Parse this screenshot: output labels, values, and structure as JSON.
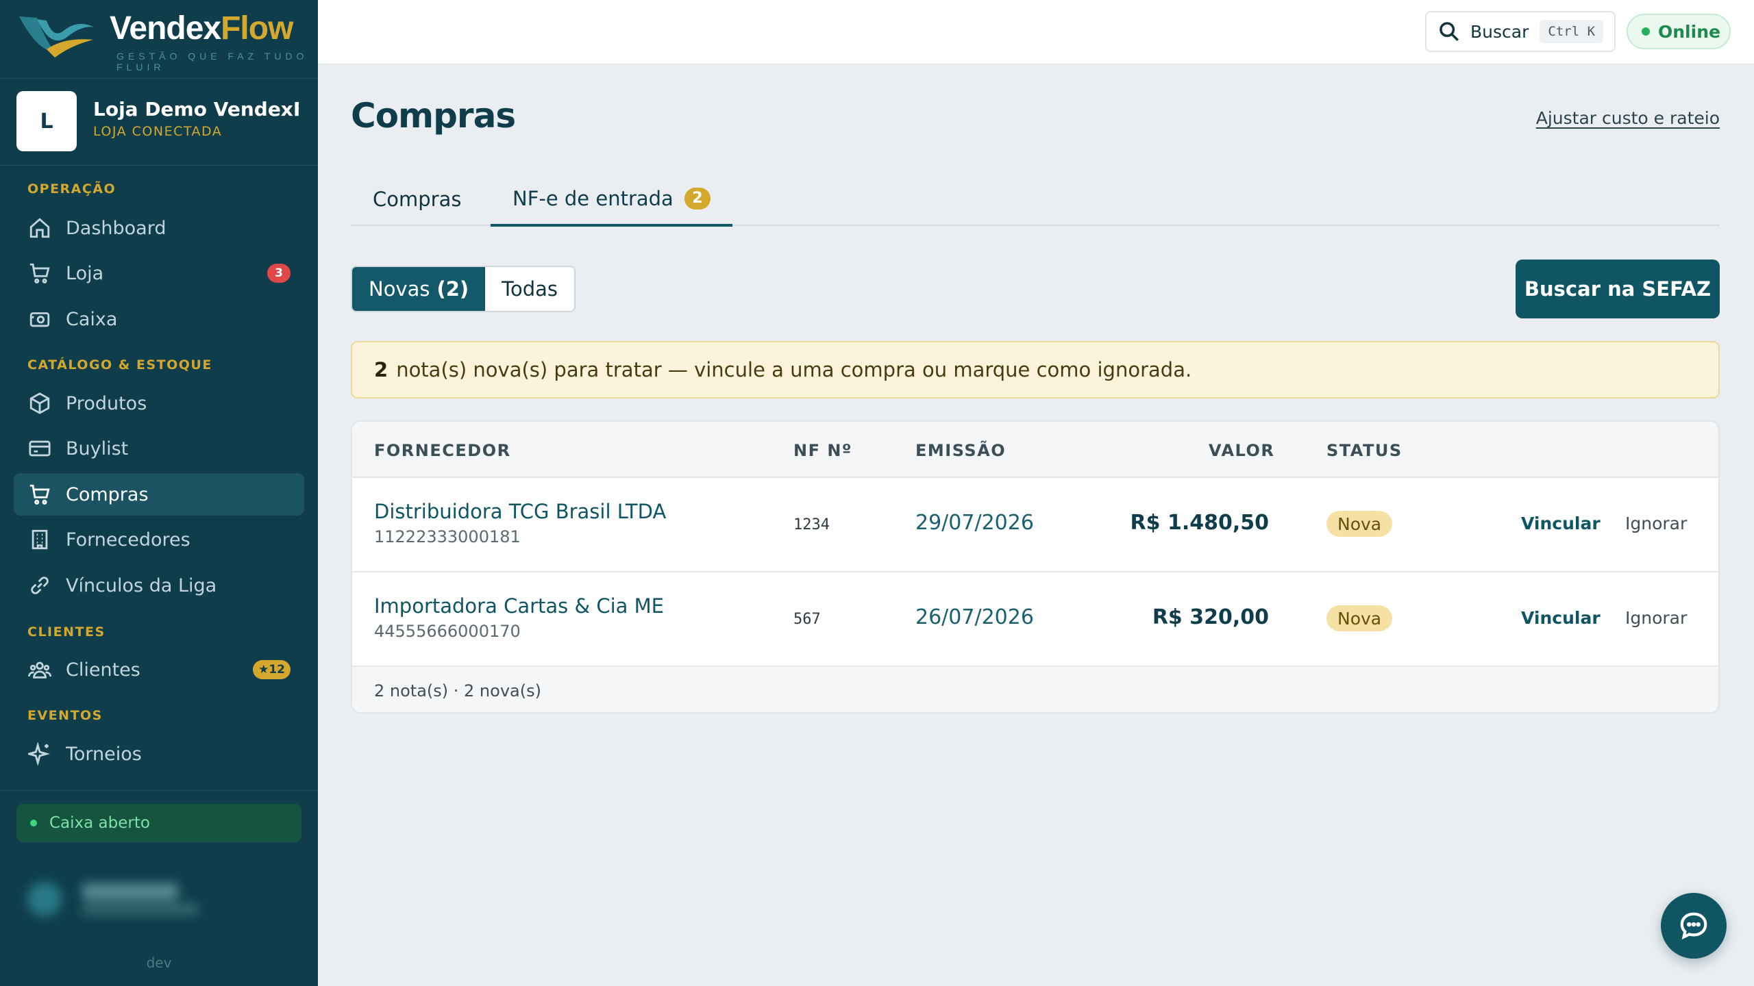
{
  "brand": {
    "name_main": "Vendex",
    "name_accent": "Flow",
    "tagline": "GESTÃO QUE FAZ TUDO FLUIR"
  },
  "store": {
    "initial": "L",
    "name": "Loja Demo VendexFl...",
    "status": "LOJA CONECTADA"
  },
  "sidebar": {
    "sections": [
      {
        "title": "OPERAÇÃO"
      },
      {
        "title": "CATÁLOGO & ESTOQUE"
      },
      {
        "title": "CLIENTES"
      },
      {
        "title": "EVENTOS"
      }
    ],
    "items": [
      {
        "label": "Dashboard",
        "icon": "home-icon"
      },
      {
        "label": "Loja",
        "icon": "cart-icon",
        "badge": "3"
      },
      {
        "label": "Caixa",
        "icon": "cash-register-icon"
      },
      {
        "label": "Produtos",
        "icon": "box-icon"
      },
      {
        "label": "Buylist",
        "icon": "card-icon"
      },
      {
        "label": "Compras",
        "icon": "cart-icon",
        "active": true
      },
      {
        "label": "Fornecedores",
        "icon": "building-icon"
      },
      {
        "label": "Vínculos da Liga",
        "icon": "link-icon"
      },
      {
        "label": "Clientes",
        "icon": "users-icon",
        "badge": "★12"
      },
      {
        "label": "Torneios",
        "icon": "sparkle-icon"
      }
    ],
    "cash_status": "Caixa aberto",
    "footer": "dev"
  },
  "topbar": {
    "search_label": "Buscar",
    "search_shortcut": "Ctrl K",
    "connection": "Online"
  },
  "page": {
    "title": "Compras",
    "header_link": "Ajustar custo e rateio",
    "tabs": [
      {
        "label": "Compras"
      },
      {
        "label": "NF-e de entrada",
        "count": "2",
        "active": true
      }
    ],
    "filters": {
      "new_label": "Novas",
      "new_count": "(2)",
      "all_label": "Todas"
    },
    "sefaz_button": "Buscar na SEFAZ",
    "alert": {
      "count": "2",
      "text": "nota(s) nova(s) para tratar — vincule a uma compra ou marque como ignorada."
    }
  },
  "table": {
    "headers": {
      "supplier": "FORNECEDOR",
      "nf": "NF Nº",
      "emission": "EMISSÃO",
      "value": "VALOR",
      "status": "STATUS"
    },
    "rows": [
      {
        "supplier": "Distribuidora TCG Brasil LTDA",
        "doc": "11222333000181",
        "nf": "1234",
        "emission": "29/07/2026",
        "value": "R$ 1.480,50",
        "status": "Nova",
        "link": "Vincular",
        "ignore": "Ignorar"
      },
      {
        "supplier": "Importadora Cartas & Cia ME",
        "doc": "44555666000170",
        "nf": "567",
        "emission": "26/07/2026",
        "value": "R$ 320,00",
        "status": "Nova",
        "link": "Vincular",
        "ignore": "Ignorar"
      }
    ],
    "footer": "2 nota(s) · 2 nova(s)"
  },
  "colors": {
    "sidebar": "#0f3d4b",
    "accent": "#d4a82c",
    "primary": "#0f5563",
    "status_new": "#f6e1a4",
    "online": "#22b35c"
  }
}
